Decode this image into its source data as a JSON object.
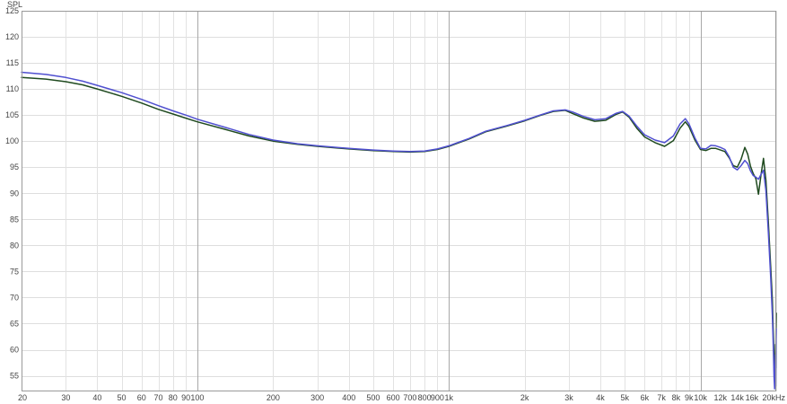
{
  "chart_data": {
    "type": "line",
    "ylabel": "SPL",
    "x_scale": "log",
    "grid": true,
    "xlim": [
      20,
      20000
    ],
    "ylim": [
      52,
      125
    ],
    "y_ticks": [
      55,
      60,
      65,
      70,
      75,
      80,
      85,
      90,
      95,
      100,
      105,
      110,
      115,
      120,
      125
    ],
    "x_ticks": [
      {
        "value": 20,
        "label": "20",
        "major": false
      },
      {
        "value": 30,
        "label": "30",
        "major": false
      },
      {
        "value": 40,
        "label": "40",
        "major": false
      },
      {
        "value": 50,
        "label": "50",
        "major": false
      },
      {
        "value": 60,
        "label": "60",
        "major": false
      },
      {
        "value": 70,
        "label": "70",
        "major": false
      },
      {
        "value": 80,
        "label": "80",
        "major": false
      },
      {
        "value": 90,
        "label": "90",
        "major": false
      },
      {
        "value": 100,
        "label": "100",
        "major": true
      },
      {
        "value": 200,
        "label": "200",
        "major": false
      },
      {
        "value": 300,
        "label": "300",
        "major": false
      },
      {
        "value": 400,
        "label": "400",
        "major": false
      },
      {
        "value": 500,
        "label": "500",
        "major": false
      },
      {
        "value": 600,
        "label": "600",
        "major": false
      },
      {
        "value": 700,
        "label": "700",
        "major": false
      },
      {
        "value": 800,
        "label": "800",
        "major": false
      },
      {
        "value": 900,
        "label": "900",
        "major": false
      },
      {
        "value": 1000,
        "label": "1k",
        "major": true
      },
      {
        "value": 2000,
        "label": "2k",
        "major": false
      },
      {
        "value": 3000,
        "label": "3k",
        "major": false
      },
      {
        "value": 4000,
        "label": "4k",
        "major": false
      },
      {
        "value": 5000,
        "label": "5k",
        "major": false
      },
      {
        "value": 6000,
        "label": "6k",
        "major": false
      },
      {
        "value": 7000,
        "label": "7k",
        "major": false
      },
      {
        "value": 8000,
        "label": "8k",
        "major": false
      },
      {
        "value": 9000,
        "label": "9k",
        "major": false
      },
      {
        "value": 10000,
        "label": "10k",
        "major": true
      },
      {
        "value": 12000,
        "label": "12k",
        "major": false,
        "faded": true
      },
      {
        "value": 14000,
        "label": "14k",
        "major": false,
        "faded": true
      },
      {
        "value": 16000,
        "label": "16k",
        "major": false,
        "faded": true
      },
      {
        "value": 20000,
        "label": "20kHz",
        "major": false
      }
    ],
    "series": [
      {
        "color": "#1f4a1f",
        "points": [
          [
            20,
            112.2
          ],
          [
            25,
            111.9
          ],
          [
            30,
            111.4
          ],
          [
            35,
            110.8
          ],
          [
            40,
            110.0
          ],
          [
            50,
            108.6
          ],
          [
            60,
            107.3
          ],
          [
            70,
            106.1
          ],
          [
            80,
            105.2
          ],
          [
            90,
            104.4
          ],
          [
            100,
            103.7
          ],
          [
            130,
            102.2
          ],
          [
            160,
            101.0
          ],
          [
            200,
            100.0
          ],
          [
            250,
            99.4
          ],
          [
            300,
            99.0
          ],
          [
            400,
            98.5
          ],
          [
            500,
            98.2
          ],
          [
            600,
            98.0
          ],
          [
            700,
            97.9
          ],
          [
            800,
            98.0
          ],
          [
            900,
            98.4
          ],
          [
            1000,
            99.0
          ],
          [
            1200,
            100.4
          ],
          [
            1400,
            101.8
          ],
          [
            1700,
            102.9
          ],
          [
            2000,
            103.9
          ],
          [
            2300,
            104.9
          ],
          [
            2600,
            105.7
          ],
          [
            2900,
            105.9
          ],
          [
            3100,
            105.3
          ],
          [
            3400,
            104.5
          ],
          [
            3800,
            103.8
          ],
          [
            4200,
            104.0
          ],
          [
            4600,
            105.1
          ],
          [
            4900,
            105.6
          ],
          [
            5200,
            104.6
          ],
          [
            5600,
            102.4
          ],
          [
            6000,
            100.8
          ],
          [
            6600,
            99.7
          ],
          [
            7200,
            99.0
          ],
          [
            7800,
            100.1
          ],
          [
            8300,
            102.5
          ],
          [
            8700,
            103.7
          ],
          [
            9000,
            102.8
          ],
          [
            9500,
            100.2
          ],
          [
            10000,
            98.4
          ],
          [
            10500,
            98.2
          ],
          [
            11000,
            98.6
          ],
          [
            11500,
            98.6
          ],
          [
            12000,
            98.3
          ],
          [
            12500,
            98.0
          ],
          [
            13000,
            96.8
          ],
          [
            13500,
            95.3
          ],
          [
            14000,
            95.0
          ],
          [
            14500,
            96.5
          ],
          [
            15000,
            98.8
          ],
          [
            15400,
            97.5
          ],
          [
            15800,
            95.2
          ],
          [
            16200,
            93.8
          ],
          [
            16600,
            92.8
          ],
          [
            17000,
            89.8
          ],
          [
            17400,
            93.5
          ],
          [
            17800,
            96.7
          ],
          [
            18200,
            92.5
          ],
          [
            18600,
            84.5
          ],
          [
            19000,
            76.0
          ],
          [
            19300,
            69.5
          ],
          [
            19500,
            62.0
          ],
          [
            19600,
            57.5
          ],
          [
            19700,
            54.0
          ],
          [
            19780,
            58.0
          ],
          [
            19850,
            61.0
          ],
          [
            19900,
            56.5
          ],
          [
            19950,
            63.5
          ],
          [
            20000,
            67.0
          ]
        ]
      },
      {
        "color": "#5050d0",
        "points": [
          [
            20,
            113.2
          ],
          [
            25,
            112.8
          ],
          [
            30,
            112.2
          ],
          [
            35,
            111.5
          ],
          [
            40,
            110.7
          ],
          [
            50,
            109.3
          ],
          [
            60,
            108.0
          ],
          [
            70,
            106.8
          ],
          [
            80,
            105.8
          ],
          [
            90,
            105.0
          ],
          [
            100,
            104.2
          ],
          [
            130,
            102.6
          ],
          [
            160,
            101.3
          ],
          [
            200,
            100.2
          ],
          [
            250,
            99.5
          ],
          [
            300,
            99.1
          ],
          [
            400,
            98.6
          ],
          [
            500,
            98.3
          ],
          [
            600,
            98.1
          ],
          [
            700,
            98.0
          ],
          [
            800,
            98.1
          ],
          [
            900,
            98.5
          ],
          [
            1000,
            99.1
          ],
          [
            1200,
            100.5
          ],
          [
            1400,
            101.9
          ],
          [
            1700,
            103.0
          ],
          [
            2000,
            104.0
          ],
          [
            2300,
            105.0
          ],
          [
            2600,
            105.8
          ],
          [
            2900,
            106.0
          ],
          [
            3100,
            105.6
          ],
          [
            3400,
            104.8
          ],
          [
            3800,
            104.1
          ],
          [
            4200,
            104.3
          ],
          [
            4600,
            105.3
          ],
          [
            4900,
            105.7
          ],
          [
            5200,
            104.8
          ],
          [
            5600,
            102.8
          ],
          [
            6000,
            101.2
          ],
          [
            6600,
            100.2
          ],
          [
            7200,
            99.7
          ],
          [
            7800,
            101.0
          ],
          [
            8300,
            103.3
          ],
          [
            8700,
            104.3
          ],
          [
            9000,
            103.3
          ],
          [
            9500,
            100.6
          ],
          [
            10000,
            98.6
          ],
          [
            10500,
            98.5
          ],
          [
            11000,
            99.2
          ],
          [
            11500,
            99.1
          ],
          [
            12000,
            98.8
          ],
          [
            12500,
            98.4
          ],
          [
            13000,
            97.0
          ],
          [
            13500,
            95.0
          ],
          [
            14000,
            94.5
          ],
          [
            14500,
            95.3
          ],
          [
            15000,
            96.3
          ],
          [
            15400,
            95.7
          ],
          [
            15800,
            94.3
          ],
          [
            16200,
            93.4
          ],
          [
            16600,
            93.1
          ],
          [
            17000,
            92.7
          ],
          [
            17400,
            93.6
          ],
          [
            17800,
            94.4
          ],
          [
            18200,
            90.5
          ],
          [
            18600,
            82.5
          ],
          [
            19000,
            74.0
          ],
          [
            19300,
            66.5
          ],
          [
            19500,
            59.5
          ],
          [
            19600,
            55.0
          ],
          [
            19700,
            52.5
          ],
          [
            19780,
            56.5
          ],
          [
            19850,
            59.0
          ],
          [
            19900,
            53.0
          ],
          [
            19950,
            61.5
          ],
          [
            20000,
            64.0
          ]
        ]
      }
    ]
  }
}
